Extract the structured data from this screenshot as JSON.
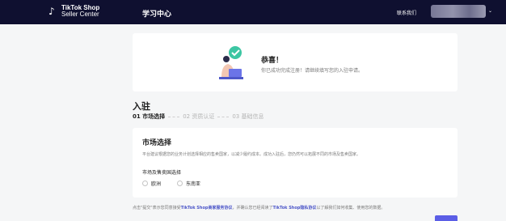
{
  "topbar": {
    "brand_line1": "TikTok Shop",
    "brand_line2": "Seller Center",
    "learn_center": "学习中心",
    "contact": "联系我们"
  },
  "success": {
    "title": "恭喜！",
    "subtitle": "你已成功完成注册！请继续填写您的入驻申请。"
  },
  "onboarding": {
    "heading": "入驻",
    "steps": [
      {
        "label": "01 市场选择",
        "active": true
      },
      {
        "label": "02 资质认证",
        "active": false
      },
      {
        "label": "03 基础信息",
        "active": false
      }
    ]
  },
  "market": {
    "title": "市场选择",
    "description": "平台建议根据您的业务计划选择相应的售卖国家，以减少履约成本。成功入驻后，您仍然可以拓展不同的市场及售卖国家。",
    "field_label": "市场及售卖国选择",
    "options": [
      "欧洲",
      "东南亚"
    ]
  },
  "agreement": {
    "prefix": "点击\"提交\"表示您同意接受",
    "link1": "TikTok Shop商家服务协议",
    "middle": "，并确认您已经阅读了",
    "link2": "TikTok Shop隐私协议",
    "suffix": "以了解我们如何收集、使用您的数据。"
  },
  "colors": {
    "topbar": "#0f1030",
    "accent": "#5b5ee6",
    "success_green": "#3cc6a3"
  }
}
